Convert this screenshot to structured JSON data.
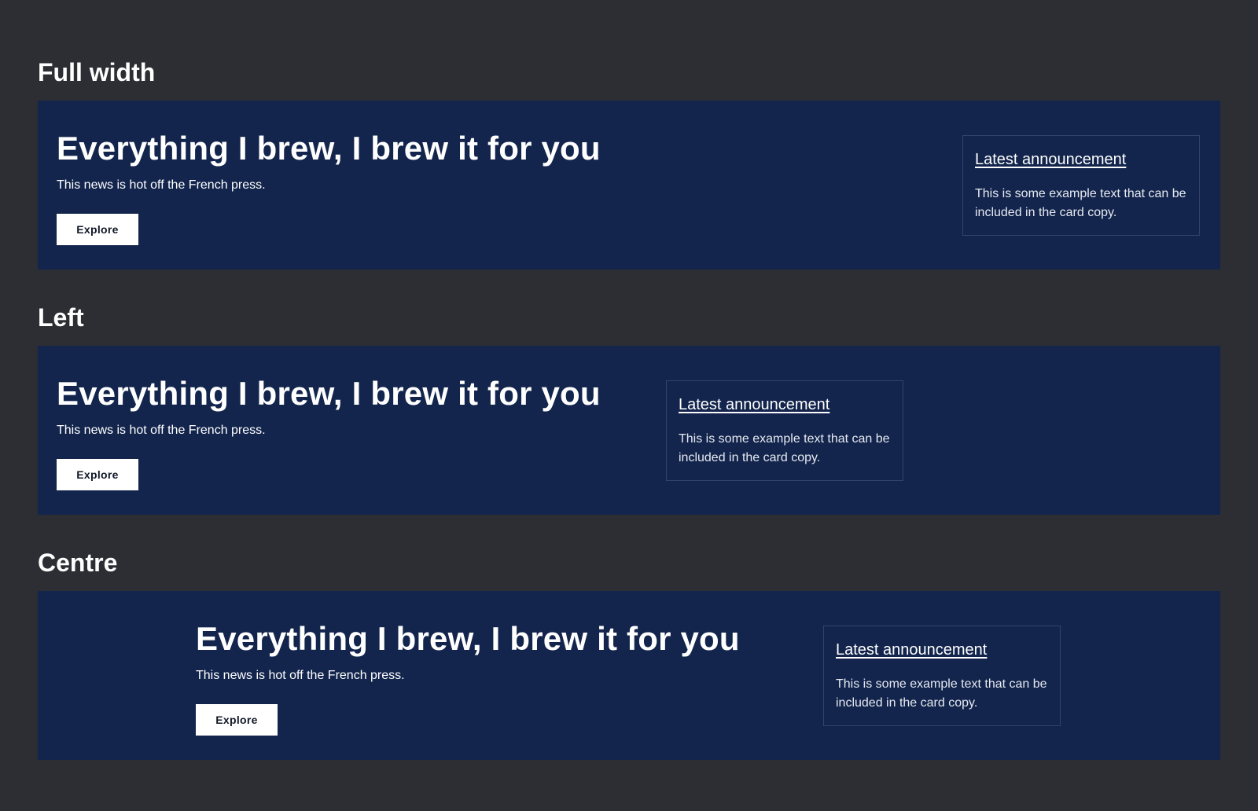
{
  "sections": [
    {
      "heading": "Full width",
      "hero_title": "Everything I brew, I brew it for you",
      "hero_subtitle": "This news is hot off the French press.",
      "button_label": "Explore",
      "card_title": "Latest announcement",
      "card_text": "This is some example text that can be included in the card copy."
    },
    {
      "heading": "Left",
      "hero_title": "Everything I brew, I brew it for you",
      "hero_subtitle": "This news is hot off the French press.",
      "button_label": "Explore",
      "card_title": "Latest announcement",
      "card_text": "This is some example text that can be included in the card copy."
    },
    {
      "heading": "Centre",
      "hero_title": "Everything I brew, I brew it for you",
      "hero_subtitle": "This news is hot off the French press.",
      "button_label": "Explore",
      "card_title": "Latest announcement",
      "card_text": "This is some example text that can be included in the card copy."
    }
  ],
  "colors": {
    "page_background": "#2c2e33",
    "banner_background": "#13254d",
    "button_background": "#ffffff",
    "card_border": "#33436a"
  }
}
